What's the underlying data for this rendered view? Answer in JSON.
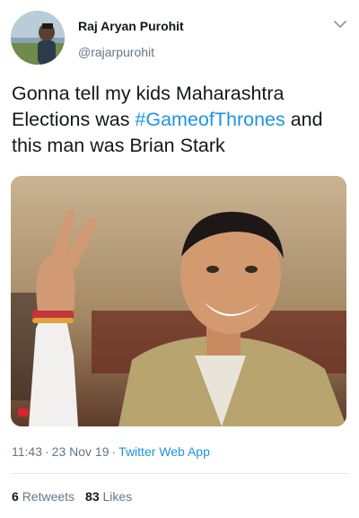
{
  "author": {
    "name": "Raj Aryan Purohit",
    "handle": "@rajarpurohit"
  },
  "tweet": {
    "text_before": "Gonna tell my kids Maharashtra Elections was ",
    "hashtag": "#GameofThrones",
    "text_after": " and this man was Brian Stark"
  },
  "meta": {
    "time": "11:43",
    "separator": "·",
    "date": "23 Nov 19",
    "source": "Twitter Web App"
  },
  "stats": {
    "retweets_count": "6",
    "retweets_label": "Retweets",
    "likes_count": "83",
    "likes_label": "Likes"
  },
  "icons": {
    "more": "chevron-down-icon"
  },
  "colors": {
    "text": "#14171a",
    "secondary": "#657786",
    "link": "#1b95e0",
    "divider": "#e1e8ed"
  }
}
